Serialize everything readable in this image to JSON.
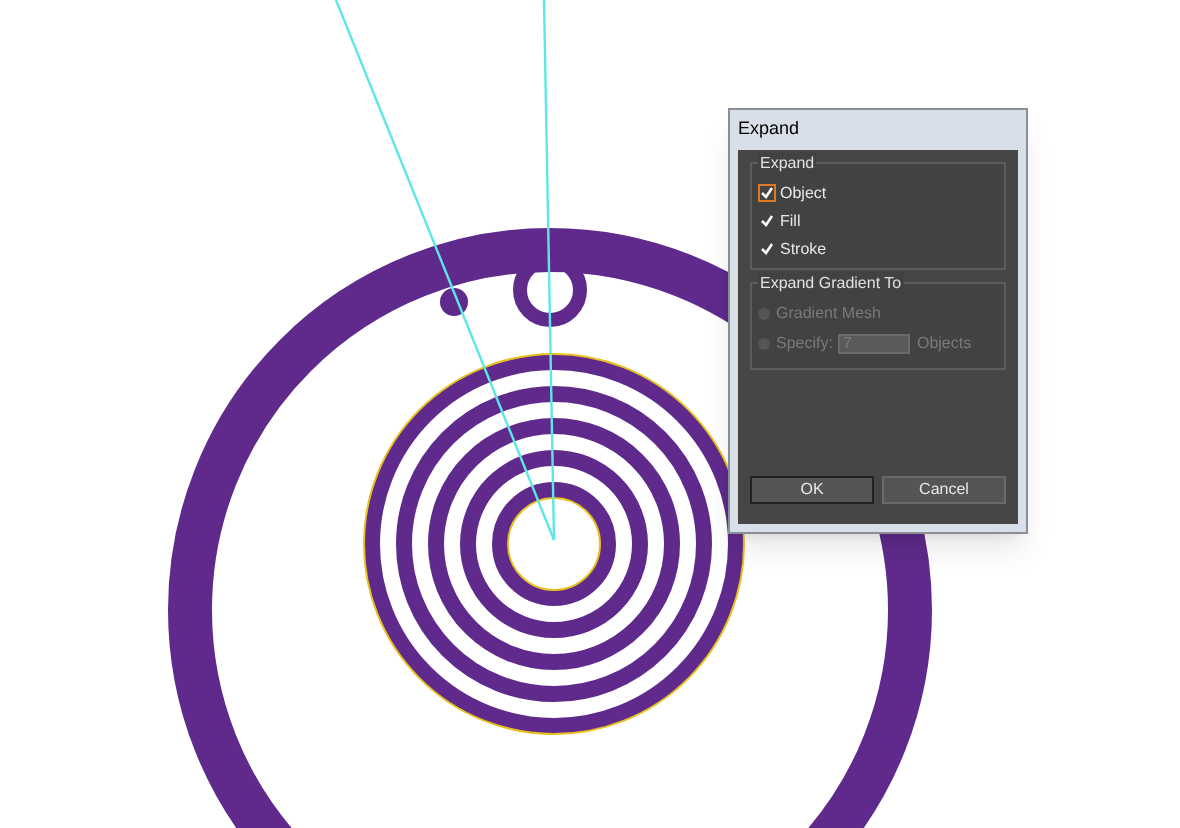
{
  "dialog": {
    "title": "Expand",
    "expand_group": {
      "label": "Expand",
      "options": [
        {
          "label": "Object",
          "checked": true,
          "focused": true
        },
        {
          "label": "Fill",
          "checked": true,
          "focused": false
        },
        {
          "label": "Stroke",
          "checked": true,
          "focused": false
        }
      ]
    },
    "gradient_group": {
      "label": "Expand Gradient To",
      "disabled": true,
      "options": [
        {
          "kind": "plain",
          "label": "Gradient Mesh",
          "selected": false
        },
        {
          "kind": "specify",
          "label": "Specify:",
          "selected": false,
          "value": "7",
          "suffix": "Objects"
        }
      ]
    },
    "buttons": [
      {
        "label": "OK",
        "default": true
      },
      {
        "label": "Cancel",
        "default": false
      }
    ]
  }
}
